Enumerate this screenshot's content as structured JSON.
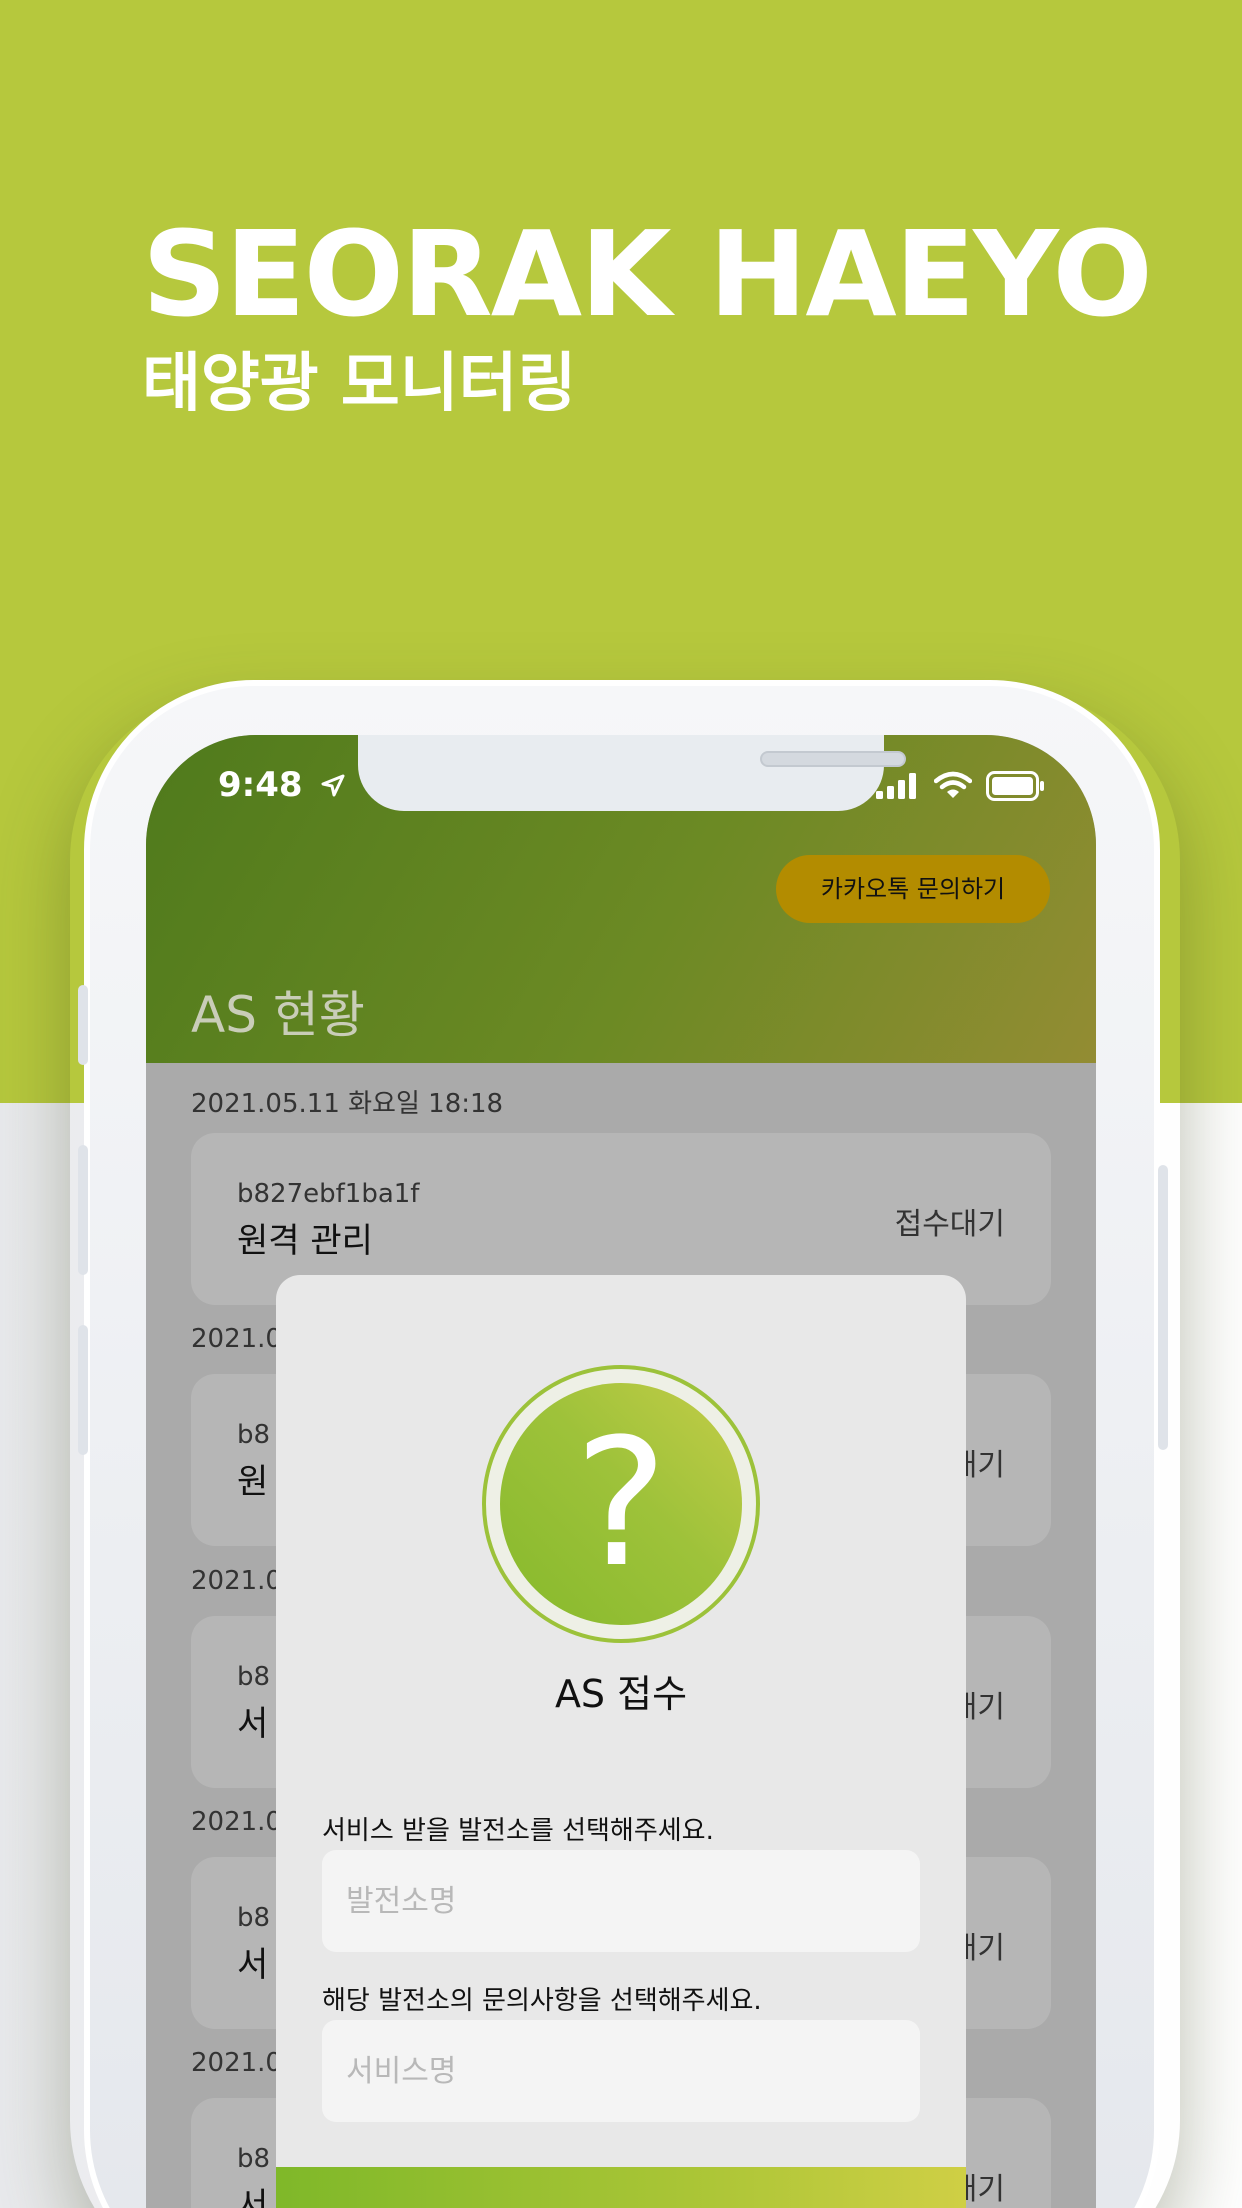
{
  "promo": {
    "title": "SEORAK HAEYO",
    "subtitle": "태양광 모니터링"
  },
  "status_bar": {
    "time": "9:48"
  },
  "header": {
    "kakao_button": "카카오톡 문의하기",
    "title": "AS 현황"
  },
  "as_list": [
    {
      "date": "2021.05.11 화요일 18:18",
      "code": "b827ebf1ba1f",
      "name": "원격 관리",
      "status": "접수대기"
    },
    {
      "date": "2021.0",
      "code": "b8",
      "name": "원",
      "status": "대기"
    },
    {
      "date": "2021.0",
      "code": "b8",
      "name": "서",
      "status": "대기"
    },
    {
      "date": "2021.0",
      "code": "b8",
      "name": "서",
      "status": "대기"
    },
    {
      "date": "2021.0",
      "code": "b8",
      "name": "서",
      "status": "대기"
    }
  ],
  "modal": {
    "icon_symbol": "?",
    "title": "AS 접수",
    "plant_label": "서비스 받을 발전소를 선택해주세요.",
    "plant_placeholder": "발전소명",
    "service_label": "해당 발전소의 문의사항을 선택해주세요.",
    "service_placeholder": "서비스명"
  },
  "colors": {
    "promo_background": "#b6c83d",
    "header_gradient_start": "#4f7a1c",
    "header_gradient_end": "#938c33",
    "kakao_button": "#b38c00",
    "accent_green": "#86b92c"
  },
  "icons": [
    "location-arrow-icon",
    "signal-icon",
    "wifi-icon",
    "battery-icon",
    "question-mark-icon"
  ]
}
